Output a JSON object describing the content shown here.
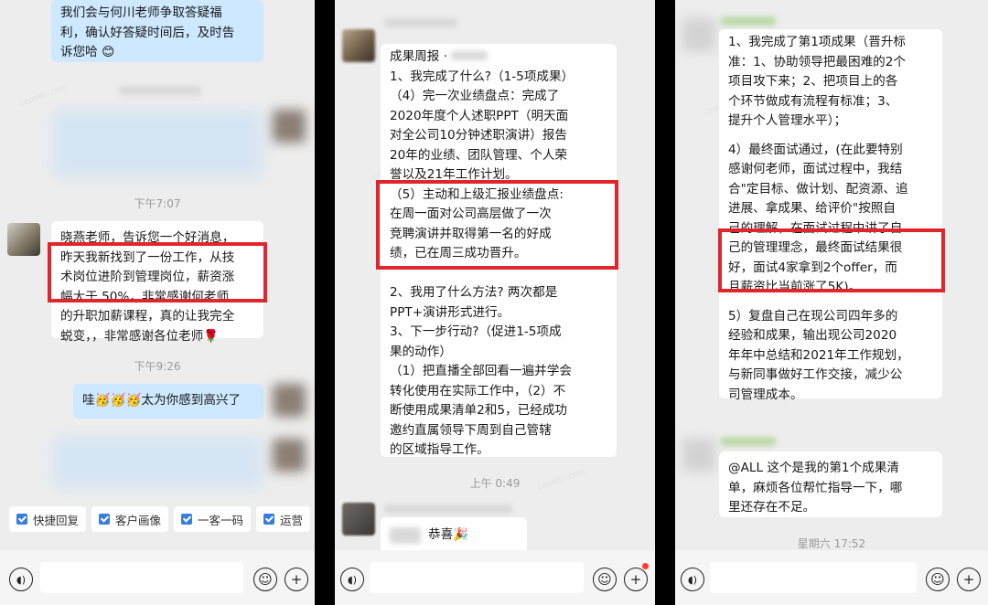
{
  "panel1": {
    "msg_top": [
      "我们会与何川老师争取答疑福",
      "利，确认好答疑时间后，及时告",
      "诉您哈 😊"
    ],
    "time1": "下午7:07",
    "msg_student": [
      "晓燕老师，告诉您一个好消息，",
      "昨天我新找到了一份工作，从技",
      "术岗位进阶到管理岗位，薪资涨",
      "幅大于 50%，非常感谢何老师",
      "的升职加薪课程，真的让我完全",
      "蜕变，，非常感谢各位老师🌹"
    ],
    "time2": "下午9:26",
    "msg_reply": "哇🥳🥳🥳太为你感到高兴了",
    "chips": [
      "快捷回复",
      "客户画像",
      "一客一码",
      "运营"
    ]
  },
  "panel2": {
    "msg_main": [
      "成果周报 ·",
      "1、我完成了什么?（1-5项成果）",
      "（4）完一次业绩盘点：完成了",
      "2020年度个人述职PPT（明天面",
      "对全公司10分钟述职演讲）报告",
      "20年的业绩、团队管理、个人荣",
      "誉以及21年工作计划。",
      "（5）主动和上级汇报业绩盘点:",
      "在周一面对公司高层做了一次",
      "竞聘演讲并取得第一名的好成",
      "绩，已在周三成功晋升。",
      "",
      "2、我用了什么方法? 两次都是",
      "PPT+演讲形式进行。",
      "3、下一步行动?（促进1-5项成",
      "果的动作）",
      "（1）把直播全部回看一遍并学会",
      "转化使用在实际工作中，（2）不",
      "断使用成果清单2和5，已经成功",
      "邀约直属领导下周到自己管辖",
      "的区域指导工作。"
    ],
    "time": "上午 0:49",
    "msg_congrats": "恭喜🎉"
  },
  "panel3": {
    "msg_main": [
      "1、我完成了第1项成果（晋升标",
      "准：1、协助领导把最困难的2个",
      "项目攻下来；2、把项目上的各",
      "个环节做成有流程有标准；3、",
      "提升个人管理水平）；",
      "",
      "4）最终面试通过，(在此要特别",
      "感谢何老师，面试过程中，我结",
      "合\"定目标、做计划、配资源、追",
      "进展、拿成果、给评价\"按照自",
      "己的理解，在面试过程中讲了自",
      "己的管理理念，最终面试结果很",
      "好，面试4家拿到2个offer，而",
      "且薪资比当前涨了5K)。",
      "",
      "5）复盘自己在现公司四年多的",
      "经验和成果，输出现公司2020",
      "年年中总结和2021年工作规划，",
      "与新同事做好工作交接，减少公",
      "司管理成本。"
    ],
    "msg_all": [
      "@ALL  这个是我的第1个成果清",
      "单，麻烦各位帮忙指导一下，哪",
      "里还存在不足。"
    ],
    "time": "星期六 17:52"
  },
  "colors": {
    "highlight": "#e0262d",
    "blue_bubble": "#cde8ff",
    "chat_bg": "#ededed"
  },
  "icons": [
    "voice-icon",
    "emoji-icon",
    "plus-icon",
    "checkbox-icon"
  ]
}
